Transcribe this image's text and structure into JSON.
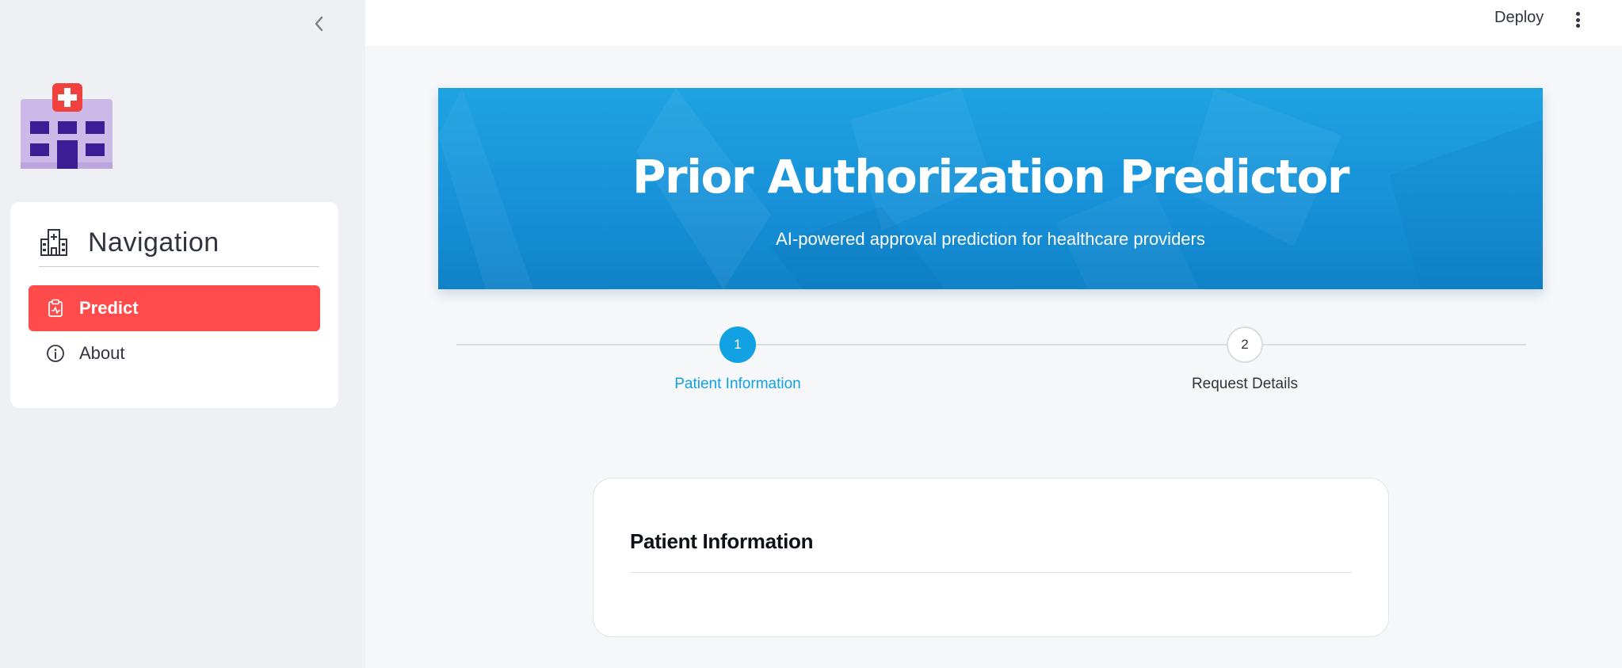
{
  "sidebar": {
    "nav_title": "Navigation",
    "items": [
      {
        "label": "Predict",
        "icon": "clipboard-pulse-icon",
        "active": true
      },
      {
        "label": "About",
        "icon": "info-icon",
        "active": false
      }
    ]
  },
  "topbar": {
    "deploy_label": "Deploy"
  },
  "hero": {
    "title": "Prior Authorization Predictor",
    "subtitle": "AI-powered approval prediction for healthcare providers"
  },
  "stepper": {
    "steps": [
      {
        "number": "1",
        "label": "Patient Information",
        "active": true
      },
      {
        "number": "2",
        "label": "Request Details",
        "active": false
      }
    ]
  },
  "card": {
    "title": "Patient Information"
  },
  "colors": {
    "accent_red": "#ff4b4b",
    "accent_blue": "#12a1e2",
    "hero_blue": "#1790d8"
  }
}
